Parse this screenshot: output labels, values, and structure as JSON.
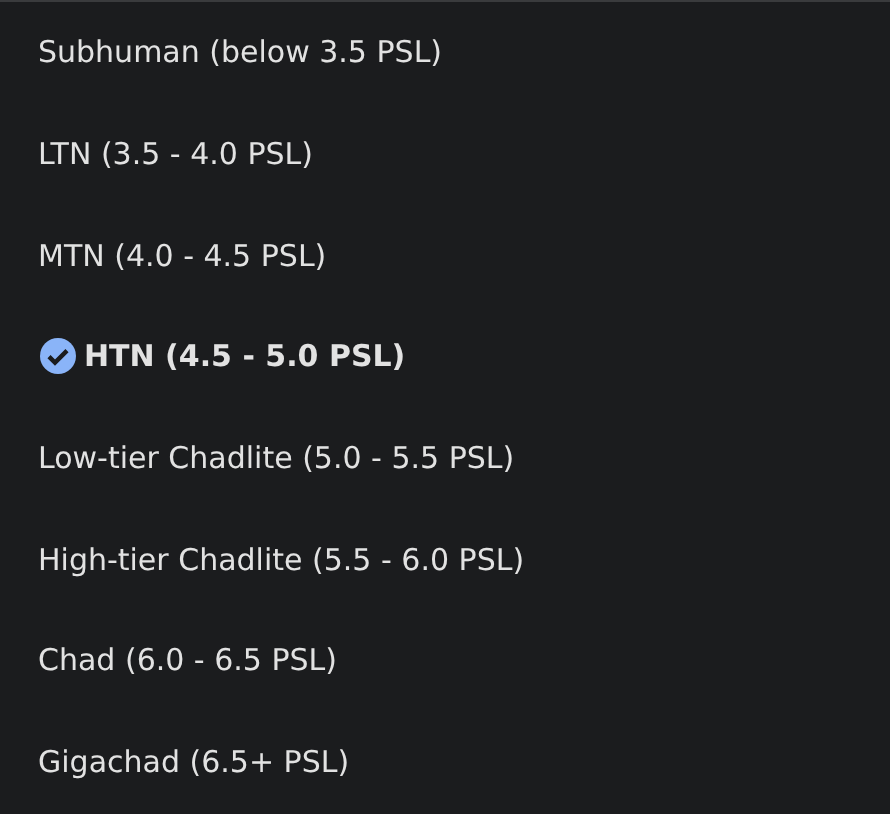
{
  "options": [
    {
      "label": "Subhuman (below 3.5 PSL)",
      "selected": false
    },
    {
      "label": "LTN (3.5 - 4.0 PSL)",
      "selected": false
    },
    {
      "label": "MTN (4.0 - 4.5 PSL)",
      "selected": false
    },
    {
      "label": "HTN (4.5 - 5.0 PSL)",
      "selected": true
    },
    {
      "label": "Low-tier Chadlite (5.0 - 5.5 PSL)",
      "selected": false
    },
    {
      "label": "High-tier Chadlite (5.5 - 6.0 PSL)",
      "selected": false
    },
    {
      "label": "Chad (6.0 - 6.5 PSL)",
      "selected": false
    },
    {
      "label": "Gigachad (6.5+ PSL)",
      "selected": false
    }
  ]
}
